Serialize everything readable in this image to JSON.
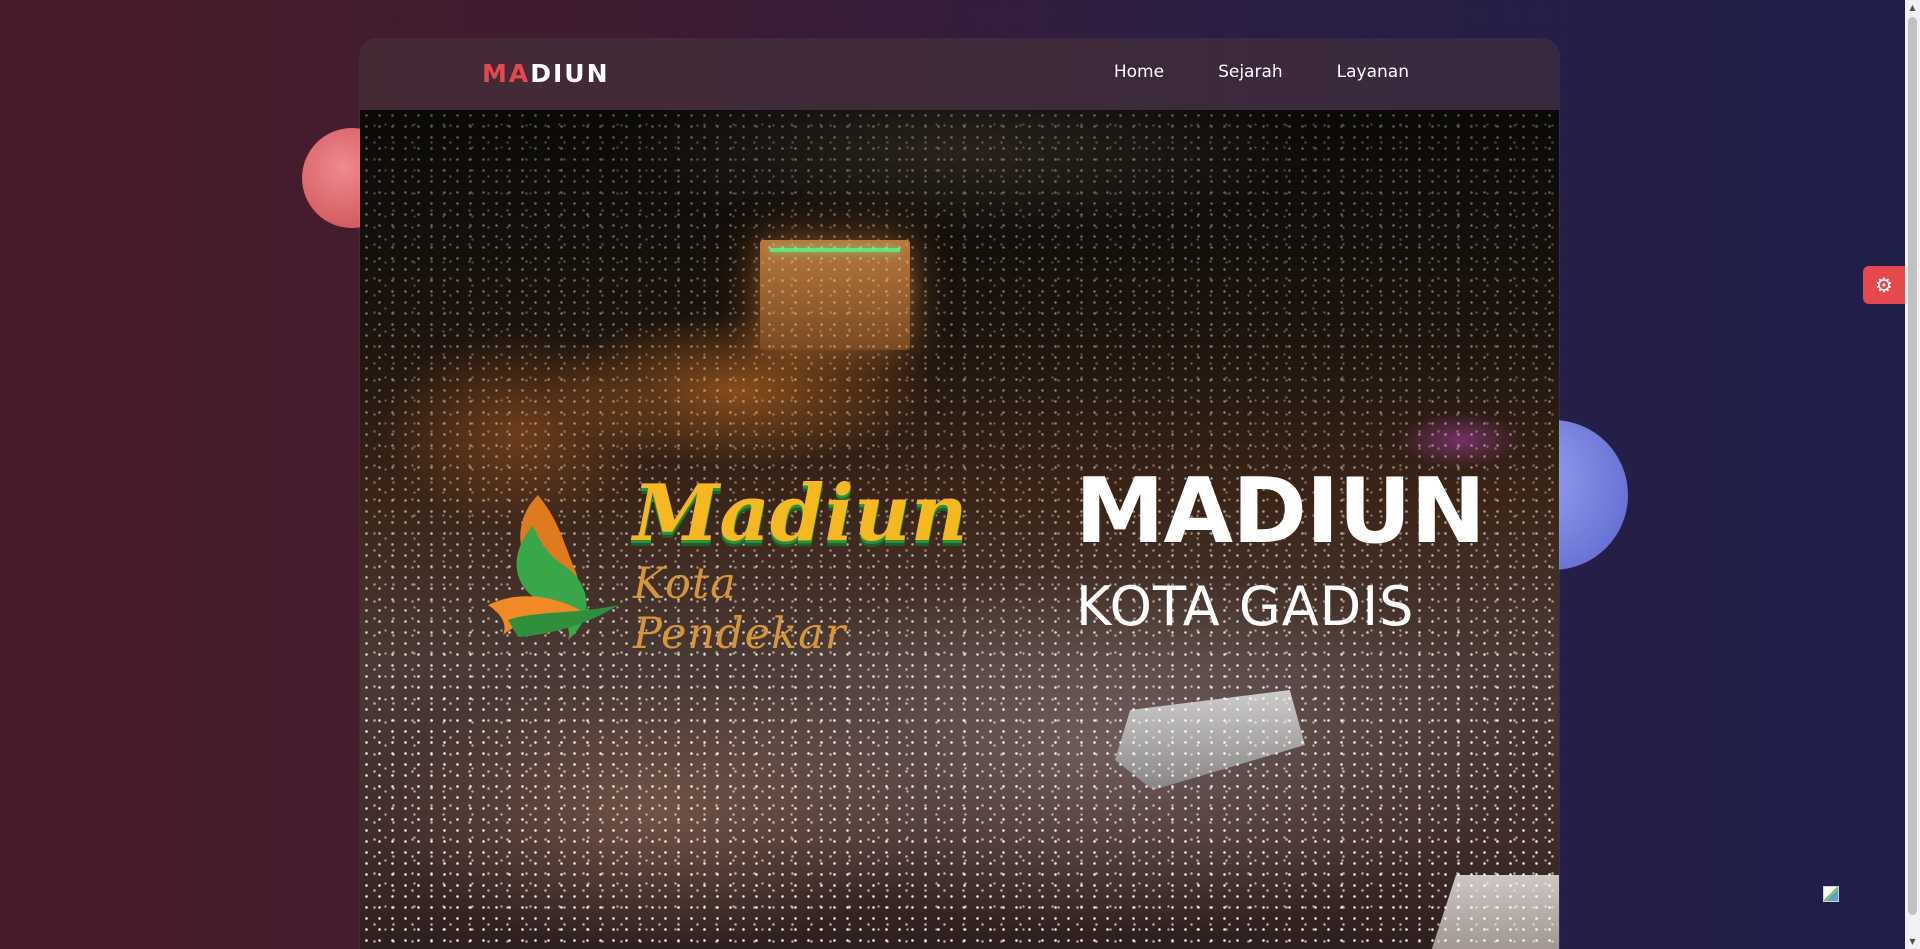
{
  "brand": {
    "logo_accent": "MA",
    "logo_rest": "DIUN",
    "accent_color": "#e5484d"
  },
  "nav": {
    "items": [
      {
        "label": "Home"
      },
      {
        "label": "Sejarah"
      },
      {
        "label": "Layanan"
      }
    ]
  },
  "hero": {
    "title": "MADIUN",
    "subtitle": "KOTA GADIS",
    "emblem": {
      "title": "Madiun",
      "subtitle": "Kota Pendekar"
    }
  },
  "settings": {
    "icon": "gear-icon"
  }
}
